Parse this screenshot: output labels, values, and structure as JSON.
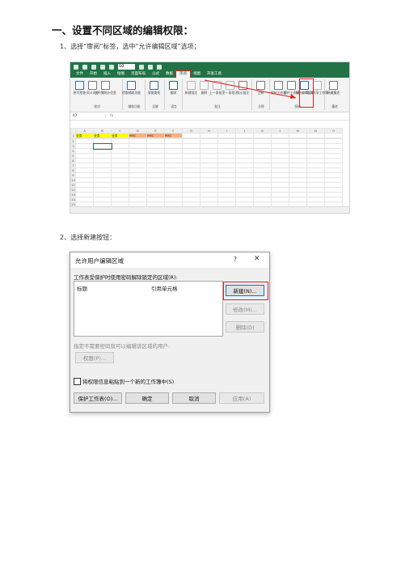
{
  "doc": {
    "heading": "一、设置不同区域的编辑权限：",
    "step1": "1、选择“审阅”标签，选中“允许编辑区域”选项；",
    "step2": "2、选择新建按钮："
  },
  "excel": {
    "font_size_value": "10",
    "menu": [
      "文件",
      "开始",
      "插入",
      "绘图",
      "页面布局",
      "公式",
      "数据",
      "审阅",
      "视图",
      "开发工具"
    ],
    "active_tab": "审阅",
    "groups": [
      {
        "name": "校对",
        "buttons": [
          "拼写检查",
          "同义词库",
          "工作簿统计信息"
        ]
      },
      {
        "name": "辅助功能",
        "buttons": [
          "检查辅助功能"
        ]
      },
      {
        "name": "见解",
        "buttons": [
          "智能查找"
        ]
      },
      {
        "name": "语言",
        "buttons": [
          "翻译"
        ]
      },
      {
        "name": "批注",
        "buttons": [
          "新建批注",
          "删除",
          "上一条批注",
          "下一条批注",
          "显示批注"
        ]
      },
      {
        "name": "注释",
        "buttons": [
          "注释"
        ]
      },
      {
        "name": "保护",
        "buttons": [
          "保护工作表",
          "保护工作簿",
          "允许编辑区域",
          "取消共享工作簿"
        ]
      },
      {
        "name": "墨迹",
        "buttons": [
          "隐藏墨迹"
        ]
      }
    ],
    "name_box": "IO",
    "fx": "fx",
    "col_headers": [
      "",
      "A",
      "B",
      "C",
      "D",
      "E",
      "F",
      "G",
      "H",
      "I",
      "J",
      "K",
      "L",
      "M",
      "N",
      "O"
    ],
    "row1": [
      "1",
      "业务",
      "业务",
      "业务",
      "PMC",
      "PMC",
      "PMC",
      "",
      "",
      "",
      "",
      "",
      "",
      "",
      "",
      ""
    ],
    "row_numbers": [
      "2",
      "3",
      "4",
      "5",
      "6",
      "7",
      "8",
      "9",
      "10",
      "11",
      "12",
      "13",
      "14",
      "15",
      "16"
    ]
  },
  "dialog": {
    "title": "允许用户编辑区域",
    "help": "?",
    "close": "✕",
    "area_label": "工作表受保护时使用密码解除锁定的区域(R):",
    "col_title": "标题",
    "col_ref": "引用单元格",
    "new_button": "新建(N)...",
    "modify_button": "修改(M)...",
    "delete_button": "删除(D)",
    "no_pwd_label": "指定不需要密码就可以编辑该区域的用户:",
    "perm_button": "权限(P)...",
    "paste_checkbox": "将权限信息粘贴到一个新的工作簿中(S)",
    "protect_button": "保护工作表(O)...",
    "ok_button": "确定",
    "cancel_button": "取消",
    "apply_button": "应用(A)"
  },
  "colors": {
    "excel_green": "#217346",
    "highlight_red": "#e02020",
    "yellow": "#ffff00",
    "orange": "#f4b183"
  }
}
